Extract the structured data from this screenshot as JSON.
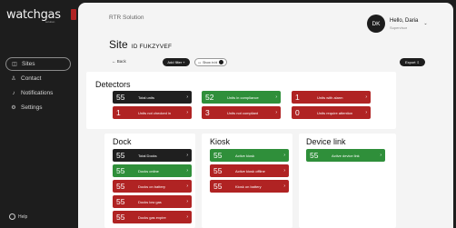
{
  "app": {
    "logo": "watchgas",
    "logo_sub": "solution"
  },
  "sidebar": {
    "items": [
      {
        "label": "Sites",
        "icon": "grid-icon",
        "active": true
      },
      {
        "label": "Contact",
        "icon": "user-icon",
        "active": false
      },
      {
        "label": "Notifications",
        "icon": "bell-icon",
        "active": false
      },
      {
        "label": "Settings",
        "icon": "gear-icon",
        "active": false
      }
    ],
    "help": "Help"
  },
  "topbar": {
    "title": "RTR Solution"
  },
  "user": {
    "initials": "DK",
    "greeting": "Hello, Daria",
    "role": "Supervisor"
  },
  "page": {
    "title": "Site",
    "site_id": "ID FUKZYVEF"
  },
  "toolbar": {
    "back": "Back",
    "add_filter": "Add filter",
    "toggle": "Show in bl",
    "export": "Export"
  },
  "colors": {
    "dark": "#1f1f1f",
    "green": "#2f8f3a",
    "red": "#b02323"
  },
  "detectors": {
    "title": "Detectors",
    "tiles": [
      {
        "value": "55",
        "label": "Total units",
        "color": "dark"
      },
      {
        "value": "52",
        "label": "Units in compliance",
        "color": "green"
      },
      {
        "value": "1",
        "label": "Units with alarm",
        "color": "red"
      },
      {
        "value": "1",
        "label": "Units not checked in",
        "color": "red"
      },
      {
        "value": "3",
        "label": "Units not compliant",
        "color": "red"
      },
      {
        "value": "0",
        "label": "Units require attention",
        "color": "red"
      }
    ]
  },
  "dock": {
    "title": "Dock",
    "tiles": [
      {
        "value": "55",
        "label": "Total Docks",
        "color": "dark"
      },
      {
        "value": "55",
        "label": "Docks online",
        "color": "green"
      },
      {
        "value": "55",
        "label": "Docks on battery",
        "color": "red"
      },
      {
        "value": "55",
        "label": "Docks low gas",
        "color": "red"
      },
      {
        "value": "55",
        "label": "Docks gas expire",
        "color": "red"
      }
    ]
  },
  "kiosk": {
    "title": "Kiosk",
    "tiles": [
      {
        "value": "55",
        "label": "Active kiosk",
        "color": "green"
      },
      {
        "value": "55",
        "label": "Active kiosk offline",
        "color": "red"
      },
      {
        "value": "55",
        "label": "Kiosk on battery",
        "color": "red"
      }
    ]
  },
  "device_link": {
    "title": "Device link",
    "tiles": [
      {
        "value": "55",
        "label": "Active device link",
        "color": "green"
      }
    ]
  }
}
